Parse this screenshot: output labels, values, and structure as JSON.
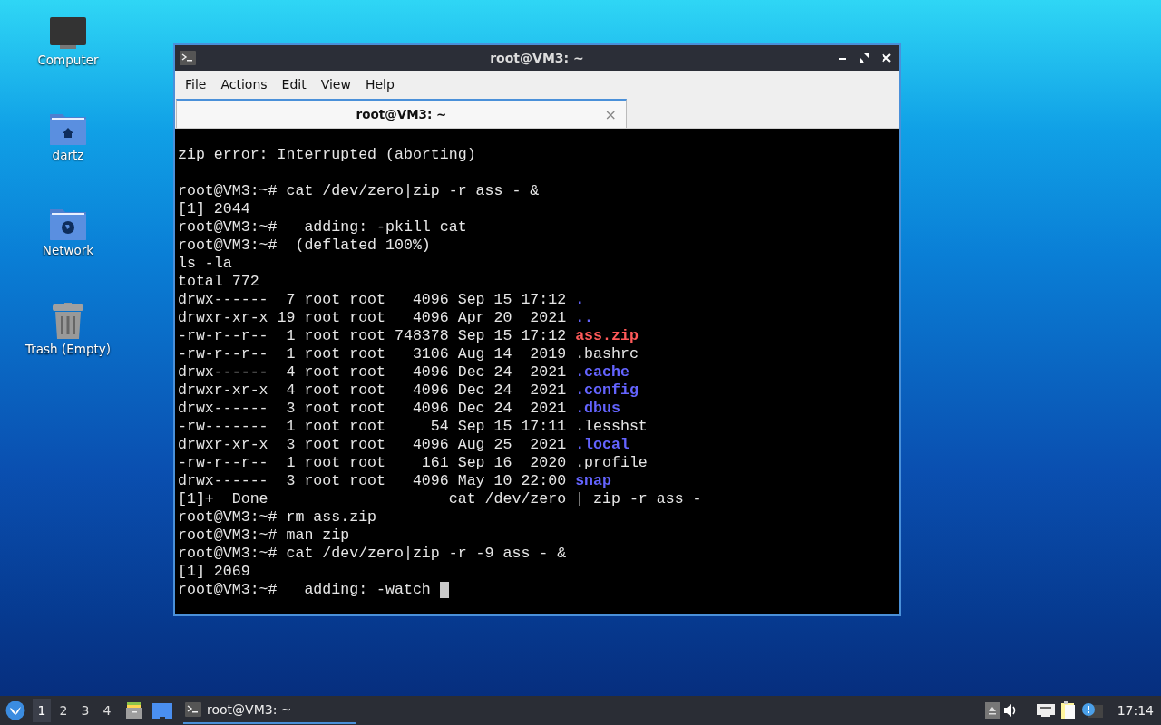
{
  "desktop": {
    "icons": [
      {
        "label": "Computer",
        "kind": "computer"
      },
      {
        "label": "dartz",
        "kind": "home"
      },
      {
        "label": "Network",
        "kind": "network"
      },
      {
        "label": "Trash (Empty)",
        "kind": "trash"
      }
    ]
  },
  "window": {
    "title": "root@VM3: ~",
    "menu": [
      "File",
      "Actions",
      "Edit",
      "View",
      "Help"
    ],
    "tabs": [
      {
        "label": "root@VM3: ~",
        "selected": true,
        "close": "×"
      }
    ],
    "terminal": {
      "lines": [
        [
          {
            "text": "zip error: Interrupted (aborting)",
            "kind": "text"
          }
        ],
        {
          "kind": "blank"
        },
        [
          {
            "text": "root@VM3:~# cat /dev/zero|zip -r ass - &",
            "kind": "text"
          }
        ],
        [
          {
            "text": "[1] 2044",
            "kind": "text"
          }
        ],
        [
          {
            "text": "root@VM3:~#   adding: -pkill cat",
            "kind": "text"
          }
        ],
        [
          {
            "text": "root@VM3:~#  (deflated 100%)",
            "kind": "text"
          }
        ],
        [
          {
            "text": "ls -la",
            "kind": "text"
          }
        ],
        [
          {
            "text": "total 772",
            "kind": "text"
          }
        ],
        [
          {
            "text": "drwx------  7 root root   4096 Sep 15 17:12 ",
            "kind": "text"
          },
          {
            "text": ".",
            "kind": "dir"
          }
        ],
        [
          {
            "text": "drwxr-xr-x 19 root root   4096 Apr 20  2021 ",
            "kind": "text"
          },
          {
            "text": "..",
            "kind": "dir"
          }
        ],
        [
          {
            "text": "-rw-r--r--  1 root root 748378 Sep 15 17:12 ",
            "kind": "text"
          },
          {
            "text": "ass.zip",
            "kind": "archive"
          }
        ],
        [
          {
            "text": "-rw-r--r--  1 root root   3106 Aug 14  2019 .bashrc",
            "kind": "text"
          }
        ],
        [
          {
            "text": "drwx------  4 root root   4096 Dec 24  2021 ",
            "kind": "text"
          },
          {
            "text": ".cache",
            "kind": "dir"
          }
        ],
        [
          {
            "text": "drwxr-xr-x  4 root root   4096 Dec 24  2021 ",
            "kind": "text"
          },
          {
            "text": ".config",
            "kind": "dir"
          }
        ],
        [
          {
            "text": "drwx------  3 root root   4096 Dec 24  2021 ",
            "kind": "text"
          },
          {
            "text": ".dbus",
            "kind": "dir"
          }
        ],
        [
          {
            "text": "-rw-------  1 root root     54 Sep 15 17:11 .lesshst",
            "kind": "text"
          }
        ],
        [
          {
            "text": "drwxr-xr-x  3 root root   4096 Aug 25  2021 ",
            "kind": "text"
          },
          {
            "text": ".local",
            "kind": "dir"
          }
        ],
        [
          {
            "text": "-rw-r--r--  1 root root    161 Sep 16  2020 .profile",
            "kind": "text"
          }
        ],
        [
          {
            "text": "drwx------  3 root root   4096 May 10 22:00 ",
            "kind": "text"
          },
          {
            "text": "snap",
            "kind": "dir"
          }
        ],
        [
          {
            "text": "[1]+  Done                    cat /dev/zero | zip -r ass -",
            "kind": "text"
          }
        ],
        [
          {
            "text": "root@VM3:~# rm ass.zip",
            "kind": "text"
          }
        ],
        [
          {
            "text": "root@VM3:~# man zip",
            "kind": "text"
          }
        ],
        [
          {
            "text": "root@VM3:~# cat /dev/zero|zip -r -9 ass - &",
            "kind": "text"
          }
        ],
        [
          {
            "text": "[1] 2069",
            "kind": "text"
          }
        ],
        [
          {
            "text": "root@VM3:~#   adding: -watch ",
            "kind": "text"
          },
          {
            "kind": "cursor"
          }
        ]
      ]
    }
  },
  "taskbar": {
    "workspaces": [
      {
        "label": "1",
        "selected": true
      },
      {
        "label": "2",
        "selected": false
      },
      {
        "label": "3",
        "selected": false
      },
      {
        "label": "4",
        "selected": false
      }
    ],
    "tasks": [
      {
        "label": "root@VM3: ~",
        "selected": true
      }
    ],
    "clock": "17:14"
  }
}
